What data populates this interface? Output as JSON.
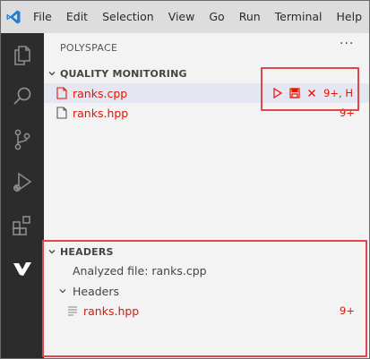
{
  "menubar": {
    "items": [
      "File",
      "Edit",
      "Selection",
      "View",
      "Go",
      "Run",
      "Terminal",
      "Help"
    ]
  },
  "activitybar": {
    "icons": [
      "explorer-icon",
      "search-icon",
      "source-control-icon",
      "run-debug-icon",
      "extensions-icon",
      "polyspace-icon"
    ]
  },
  "sidebar": {
    "title": "POLYSPACE",
    "more": "···",
    "quality": {
      "header": "QUALITY MONITORING",
      "files": [
        {
          "name": "ranks.cpp",
          "status": "9+, H"
        },
        {
          "name": "ranks.hpp",
          "status": "9+"
        }
      ]
    },
    "headers": {
      "header": "HEADERS",
      "analyzed": "Analyzed file: ranks.cpp",
      "group": "Headers",
      "file": {
        "name": "ranks.hpp",
        "status": "9+"
      }
    }
  },
  "colors": {
    "accent_red": "#e51400",
    "highlight_border": "#e0474c",
    "activity_bg": "#2c2c2c"
  }
}
